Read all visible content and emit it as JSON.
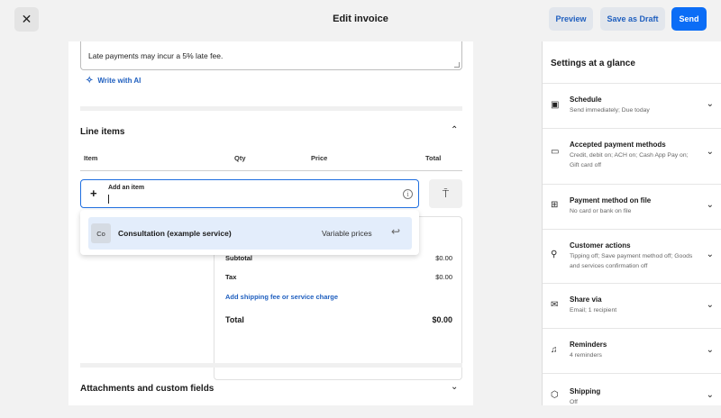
{
  "header": {
    "close_icon": "close-icon",
    "title": "Edit invoice",
    "preview_label": "Preview",
    "draft_label": "Save as Draft",
    "send_label": "Send"
  },
  "notes": {
    "text": "Late payments may incur a 5% late fee.",
    "ai_label": "Write with AI"
  },
  "line_items": {
    "title": "Line items",
    "columns": [
      "Item",
      "Qty",
      "Price",
      "Total"
    ],
    "add_item_label": "Add an item",
    "dropdown": {
      "avatar": "Co",
      "name": "Consultation (example service)",
      "price": "Variable prices"
    }
  },
  "summary": {
    "subtotal_label": "Subtotal",
    "subtotal_value": "$0.00",
    "tax_label": "Tax",
    "tax_value": "$0.00",
    "shipping_link": "Add shipping fee or service charge",
    "total_label": "Total",
    "total_value": "$0.00"
  },
  "attachments": {
    "title": "Attachments and custom fields"
  },
  "sidebar": {
    "title": "Settings at a glance",
    "items": [
      {
        "icon": "calendar-icon",
        "label": "Schedule",
        "sub": "Send immediately; Due today"
      },
      {
        "icon": "card-icon",
        "label": "Accepted payment methods",
        "sub": "Credit, debit on; ACH on; Cash App Pay on; Gift card off"
      },
      {
        "icon": "card-add-icon",
        "label": "Payment method on file",
        "sub": "No card or bank on file"
      },
      {
        "icon": "person-icon",
        "label": "Customer actions",
        "sub": "Tipping off; Save payment method off; Goods and services confirmation off"
      },
      {
        "icon": "mail-icon",
        "label": "Share via",
        "sub": "Email; 1 recipient"
      },
      {
        "icon": "bell-icon",
        "label": "Reminders",
        "sub": "4 reminders"
      },
      {
        "icon": "box-icon",
        "label": "Shipping",
        "sub": "Off"
      }
    ]
  }
}
